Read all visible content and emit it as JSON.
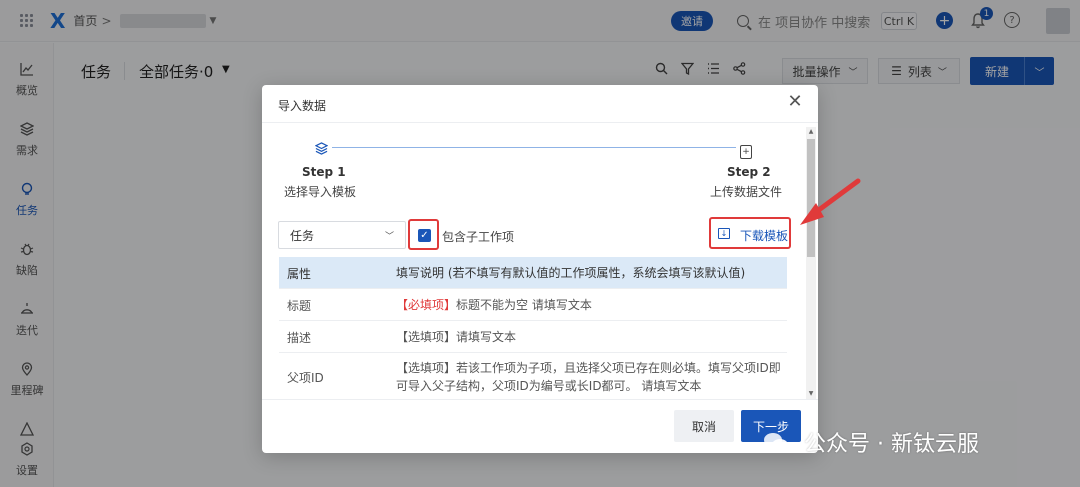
{
  "topbar": {
    "home": "首页",
    "separator": ">",
    "invite": "邀请",
    "search_placeholder": "在 项目协作 中搜索",
    "shortcut": "Ctrl K",
    "notification_count": "1",
    "help": "?"
  },
  "sidebar": {
    "items": [
      {
        "label": "概览",
        "icon": "chart-line-icon"
      },
      {
        "label": "需求",
        "icon": "layers-icon"
      },
      {
        "label": "任务",
        "icon": "bulb-icon",
        "active": true
      },
      {
        "label": "缺陷",
        "icon": "bug-icon"
      },
      {
        "label": "迭代",
        "icon": "cycle-icon"
      },
      {
        "label": "里程碑",
        "icon": "pin-icon"
      },
      {
        "label": "设置",
        "icon": "settings-icon"
      }
    ]
  },
  "page": {
    "title": "任务",
    "filter": "全部任务·0",
    "batch": "批量操作",
    "list": "列表",
    "new": "新建"
  },
  "modal": {
    "title": "导入数据",
    "step1": {
      "label": "Step 1",
      "desc": "选择导入模板"
    },
    "step2": {
      "label": "Step 2",
      "desc": "上传数据文件"
    },
    "type_value": "任务",
    "checkbox_label": "包含子工作项",
    "checkbox_checked": true,
    "download": "下载模板",
    "table": {
      "header": {
        "attr": "属性",
        "desc": "填写说明 (若不填写有默认值的工作项属性，系统会填写该默认值)"
      },
      "rows": [
        {
          "attr": "标题",
          "tag": "【必填项】",
          "desc": "标题不能为空 请填写文本"
        },
        {
          "attr": "描述",
          "tag": "",
          "desc": "【选填项】请填写文本"
        },
        {
          "attr": "父项ID",
          "tag": "",
          "desc": "【选填项】若该工作项为子项，且选择父项已存在则必填。填写父项ID即可导入父子结构，父项ID为编号或长ID都可。 请填写文本"
        }
      ]
    },
    "cancel": "取消",
    "next": "下一步"
  },
  "watermark": "公众号 · 新钛云服",
  "colors": {
    "accent": "#1a56b8",
    "highlight": "#e03a3a",
    "header_row": "#dbe9f7"
  }
}
